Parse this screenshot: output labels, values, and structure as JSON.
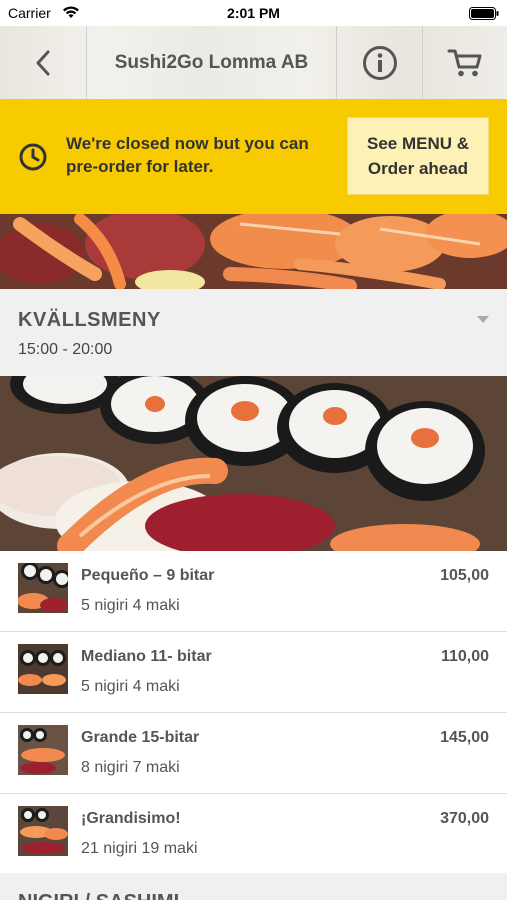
{
  "status_bar": {
    "carrier": "Carrier",
    "time": "2:01 PM"
  },
  "header": {
    "title": "Sushi2Go Lomma AB",
    "icons": [
      "back-chevron-icon",
      "info-icon",
      "cart-icon"
    ]
  },
  "banner": {
    "message": "We're closed now but you can pre-order for later.",
    "cta_label": "See MENU & Order ahead",
    "color": "#f8cb00"
  },
  "section": {
    "name": "KVÄLLSMENY",
    "hours": "15:00 - 20:00"
  },
  "items": [
    {
      "name": "Pequeño – 9 bitar",
      "desc": "5 nigiri 4 maki",
      "price": "105,00"
    },
    {
      "name": "Mediano 11- bitar",
      "desc": "5 nigiri 4 maki",
      "price": "110,00"
    },
    {
      "name": "Grande 15-bitar",
      "desc": "8 nigiri 7 maki",
      "price": "145,00"
    },
    {
      "name": "¡Grandisimo!",
      "desc": "21 nigiri 19 maki",
      "price": "370,00"
    }
  ],
  "next_section": {
    "name": "NIGIRI / SASHIMI"
  }
}
